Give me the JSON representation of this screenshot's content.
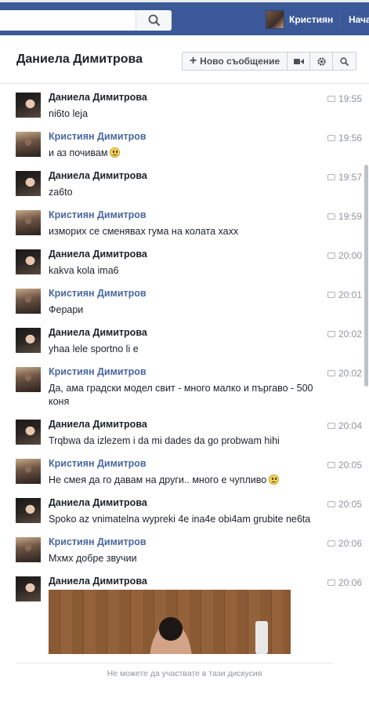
{
  "topbar": {
    "user_name": "Кристиян",
    "home_label": "Нача",
    "search_icon": "search-icon"
  },
  "conversation": {
    "title": "Даниела Димитрова",
    "new_message_label": "Ново съобщение",
    "video_icon": "video-icon",
    "settings_icon": "gear-icon",
    "search_icon": "search-icon"
  },
  "messages": [
    {
      "sender": "Даниела Димитрова",
      "who": "d",
      "text": "ni6to leja",
      "time": "19:55"
    },
    {
      "sender": "Кристиян Димитров",
      "who": "k",
      "text": "и аз почивам",
      "emoji": true,
      "time": "19:56"
    },
    {
      "sender": "Даниела Димитрова",
      "who": "d",
      "text": "za6to",
      "time": "19:57"
    },
    {
      "sender": "Кристиян Димитров",
      "who": "k",
      "text": "изморих се сменявах гума на колата хахх",
      "time": "19:59"
    },
    {
      "sender": "Даниела Димитрова",
      "who": "d",
      "text": "kakva kola ima6",
      "time": "20:00"
    },
    {
      "sender": "Кристиян Димитров",
      "who": "k",
      "text": "Ферари",
      "time": "20:01"
    },
    {
      "sender": "Даниела Димитрова",
      "who": "d",
      "text": "yhaa lele sportno li e",
      "time": "20:02"
    },
    {
      "sender": "Кристиян Димитров",
      "who": "k",
      "text": "Да, ама градски модел свит - много малко и пъргаво - 500 коня",
      "time": "20:02"
    },
    {
      "sender": "Даниела Димитрова",
      "who": "d",
      "text": "Trqbwa da izlezem i da mi dades da go probwam hihi",
      "time": "20:04"
    },
    {
      "sender": "Кристиян Димитров",
      "who": "k",
      "text": "Не смея да го давам на други.. много е чупливо",
      "emoji": true,
      "time": "20:05"
    },
    {
      "sender": "Даниела Димитрова",
      "who": "d",
      "text": "Spoko az vnimatelna wypreki 4e ina4e obi4am grubite ne6ta",
      "time": "20:05"
    },
    {
      "sender": "Кристиян Димитров",
      "who": "k",
      "text": "Мхмх добре звучии",
      "time": "20:06"
    },
    {
      "sender": "Даниела Димитрова",
      "who": "d",
      "text": "",
      "time": "20:06"
    }
  ],
  "footer": {
    "notice": "Не можете да участвате в тази дискусия"
  }
}
